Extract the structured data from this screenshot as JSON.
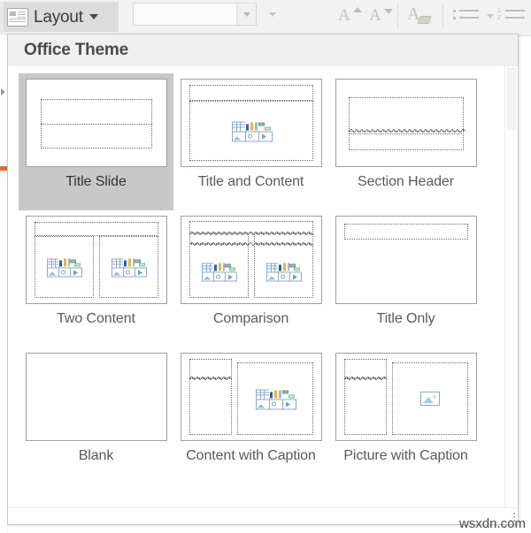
{
  "ribbon": {
    "layout_button": {
      "label": "Layout",
      "icon": "slide-layout-icon",
      "caret": "chevron-down-icon"
    },
    "font_combo": {
      "value": "",
      "placeholder": ""
    },
    "grow_font": {
      "glyph": "A",
      "icon": "increase-font-size-icon"
    },
    "shrink_font": {
      "glyph": "A",
      "icon": "decrease-font-size-icon"
    },
    "clear_formatting": {
      "glyph": "A",
      "icon": "clear-formatting-icon"
    },
    "bullets": {
      "icon": "bullet-list-icon"
    },
    "numbering": {
      "icon": "numbered-list-icon",
      "n1": "1",
      "n2": "2"
    }
  },
  "gallery": {
    "header_title": "Office Theme",
    "selected_index": 0,
    "rows": [
      [
        {
          "label": "Title Slide",
          "kind": "title-slide",
          "selected": true
        },
        {
          "label": "Title and Content",
          "kind": "title-and-content",
          "selected": false
        },
        {
          "label": "Section Header",
          "kind": "section-header",
          "selected": false
        }
      ],
      [
        {
          "label": "Two Content",
          "kind": "two-content",
          "selected": false
        },
        {
          "label": "Comparison",
          "kind": "comparison",
          "selected": false
        },
        {
          "label": "Title Only",
          "kind": "title-only",
          "selected": false
        }
      ],
      [
        {
          "label": "Blank",
          "kind": "blank",
          "selected": false
        },
        {
          "label": "Content with Caption",
          "kind": "content-with-caption",
          "selected": false
        },
        {
          "label": "Picture with Caption",
          "kind": "picture-with-caption",
          "selected": false
        }
      ]
    ]
  },
  "watermark": {
    "text": "wsxdn.com"
  },
  "colors": {
    "selected_cell": "#c8c8c8",
    "thumb_border": "#9aa0ab",
    "placeholder_dotted": "#6b6b6b",
    "header_bg": "#f0f0f0",
    "ribbon_bg": "#f2f2f2",
    "accent_orange": "#e8663c",
    "label_text": "#5a5a5a"
  }
}
